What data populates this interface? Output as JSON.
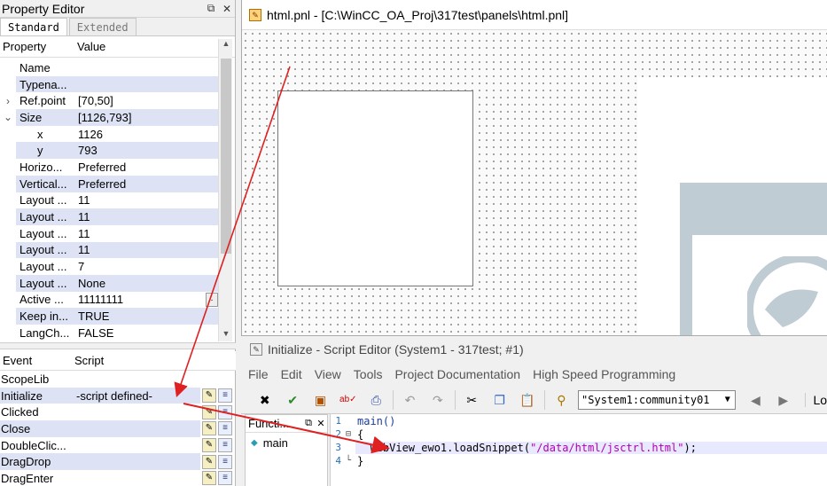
{
  "property_editor": {
    "title": "Property Editor",
    "tabs": [
      {
        "label": "Standard",
        "active": true
      },
      {
        "label": "Extended",
        "active": false
      }
    ],
    "columns": {
      "property": "Property",
      "value": "Value"
    },
    "rows": [
      {
        "name": "Name",
        "value": "",
        "alt": false,
        "expander": "",
        "indent": false
      },
      {
        "name": "Typena...",
        "value": "",
        "alt": true,
        "expander": "",
        "indent": false
      },
      {
        "name": "Ref.point",
        "value": "[70,50]",
        "alt": false,
        "expander": ">",
        "indent": false
      },
      {
        "name": "Size",
        "value": "[1126,793]",
        "alt": true,
        "expander": "v",
        "indent": false
      },
      {
        "name": "x",
        "value": "1126",
        "alt": false,
        "expander": "",
        "indent": true
      },
      {
        "name": "y",
        "value": "793",
        "alt": true,
        "expander": "",
        "indent": true
      },
      {
        "name": "Horizo...",
        "value": "Preferred",
        "alt": false,
        "expander": "",
        "indent": false
      },
      {
        "name": "Vertical...",
        "value": "Preferred",
        "alt": true,
        "expander": "",
        "indent": false
      },
      {
        "name": "Layout ...",
        "value": "11",
        "alt": false,
        "expander": "",
        "indent": false
      },
      {
        "name": "Layout ...",
        "value": "11",
        "alt": true,
        "expander": "",
        "indent": false
      },
      {
        "name": "Layout ...",
        "value": "11",
        "alt": false,
        "expander": "",
        "indent": false
      },
      {
        "name": "Layout ...",
        "value": "11",
        "alt": true,
        "expander": "",
        "indent": false
      },
      {
        "name": "Layout ...",
        "value": "7",
        "alt": false,
        "expander": "",
        "indent": false
      },
      {
        "name": "Layout ...",
        "value": "None",
        "alt": true,
        "expander": "",
        "indent": false
      },
      {
        "name": "Active ...",
        "value": "11111111",
        "alt": false,
        "expander": "",
        "indent": false,
        "has_button": true
      },
      {
        "name": "Keep in...",
        "value": "TRUE",
        "alt": true,
        "expander": "",
        "indent": false
      },
      {
        "name": "LangCh...",
        "value": "FALSE",
        "alt": false,
        "expander": "",
        "indent": false
      }
    ],
    "event_columns": {
      "event": "Event",
      "script": "Script"
    },
    "events": [
      {
        "name": "ScopeLib",
        "script": "",
        "alt": false,
        "buttons": false
      },
      {
        "name": "Initialize",
        "script": "-script defined-",
        "alt": true,
        "buttons": true
      },
      {
        "name": "Clicked",
        "script": "",
        "alt": false,
        "buttons": true
      },
      {
        "name": "Close",
        "script": "",
        "alt": true,
        "buttons": true
      },
      {
        "name": "DoubleClic...",
        "script": "",
        "alt": false,
        "buttons": true
      },
      {
        "name": "DragDrop",
        "script": "",
        "alt": true,
        "buttons": true
      },
      {
        "name": "DragEnter",
        "script": "",
        "alt": false,
        "buttons": true
      }
    ]
  },
  "panel_window": {
    "title": "html.pnl - [C:\\WinCC_OA_Proj\\317test\\panels\\html.pnl]"
  },
  "script_editor": {
    "title": "Initialize - Script Editor (System1 - 317test; #1)",
    "menu": [
      "File",
      "Edit",
      "View",
      "Tools",
      "Project Documentation",
      "High Speed Programming"
    ],
    "datapoint_combo": "\"System1:community01",
    "toolbar_trailing": "Lo",
    "functions_header": "Functi...",
    "functions": [
      "main"
    ],
    "code_lines": [
      {
        "num": "1",
        "fold": "",
        "prefix": "",
        "ident": "main()",
        "str": "",
        "suffix": "",
        "highlight": false
      },
      {
        "num": "2",
        "fold": "⊟",
        "prefix": "{",
        "ident": "",
        "str": "",
        "suffix": "",
        "highlight": false
      },
      {
        "num": "3",
        "fold": "",
        "prefix": "  WebView_ewo1.loadSnippet(",
        "ident": "",
        "str": "\"/data/html/jsctrl.html\"",
        "suffix": ");",
        "highlight": true
      },
      {
        "num": "4",
        "fold": "└",
        "prefix": "}",
        "ident": "",
        "str": "",
        "suffix": "",
        "highlight": false
      }
    ]
  },
  "colors": {
    "annotation_arrow": "#e02020",
    "row_highlight": "#dde3f5"
  }
}
